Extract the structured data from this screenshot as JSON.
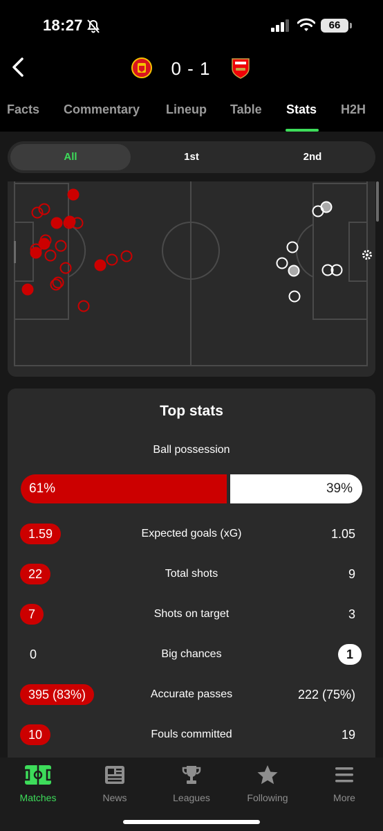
{
  "status_bar": {
    "time": "18:27",
    "battery": "66"
  },
  "header": {
    "score": "0 - 1",
    "home_team_logo": "manchester-united-crest",
    "away_team_logo": "arsenal-crest",
    "home_color": "#cc0000",
    "away_color": "#ffffff"
  },
  "tabs": [
    "Facts",
    "Commentary",
    "Lineup",
    "Table",
    "Stats",
    "H2H"
  ],
  "active_tab": "Stats",
  "periods": [
    "All",
    "1st",
    "2nd"
  ],
  "active_period": "All",
  "top_stats": {
    "title": "Top stats",
    "possession": {
      "label": "Ball possession",
      "home": "61%",
      "away": "39%",
      "home_share": 0.61
    },
    "rows": [
      {
        "label": "Expected goals (xG)",
        "home": "1.59",
        "away": "1.05",
        "highlight": "home"
      },
      {
        "label": "Total shots",
        "home": "22",
        "away": "9",
        "highlight": "home"
      },
      {
        "label": "Shots on target",
        "home": "7",
        "away": "3",
        "highlight": "home"
      },
      {
        "label": "Big chances",
        "home": "0",
        "away": "1",
        "highlight": "away"
      },
      {
        "label": "Accurate passes",
        "home": "395 (83%)",
        "away": "222 (75%)",
        "highlight": "home"
      },
      {
        "label": "Fouls committed",
        "home": "10",
        "away": "19",
        "highlight": "home"
      }
    ]
  },
  "bottom_nav": [
    {
      "label": "Matches",
      "icon": "pitch-icon",
      "active": true
    },
    {
      "label": "News",
      "icon": "newspaper-icon",
      "active": false
    },
    {
      "label": "Leagues",
      "icon": "trophy-icon",
      "active": false
    },
    {
      "label": "Following",
      "icon": "star-icon",
      "active": false
    },
    {
      "label": "More",
      "icon": "menu-icon",
      "active": false
    }
  ],
  "accent_color": "#3ddc5a"
}
